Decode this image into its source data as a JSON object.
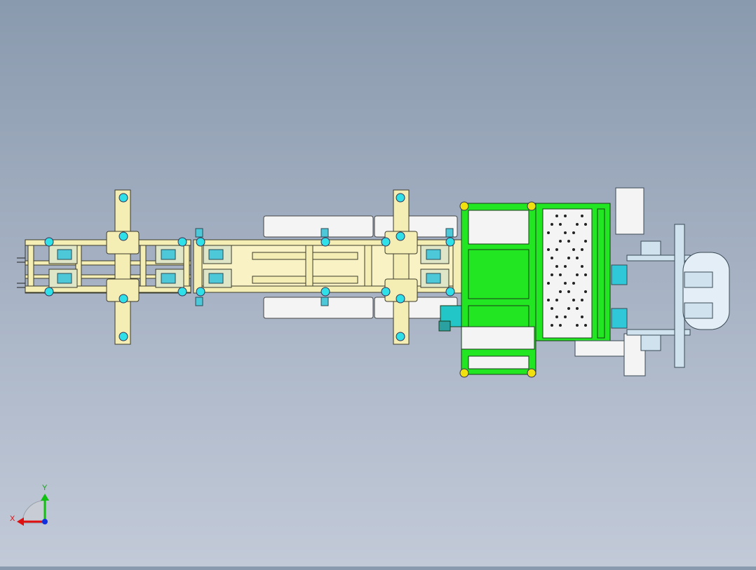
{
  "colors": {
    "background_top": "#8a9aae",
    "background_bottom": "#c2cad8",
    "frame_beige": "#f5eeb4",
    "frame_stroke": "#3a3a2a",
    "station_green": "#22e622",
    "dark_green": "#0a8a0a",
    "white_part": "#f4f4f4",
    "cyan_marker": "#2fe0e8",
    "yellow_marker": "#f0e010",
    "light_blue_part": "#cfe2ee",
    "axis_x": "#e01010",
    "axis_y": "#10c010",
    "axis_z": "#1030e0"
  },
  "triad": {
    "x_label": "X",
    "y_label": "Y"
  },
  "icons": {
    "triad": "coordinate-triad-icon",
    "marker": "circle-marker-icon"
  }
}
